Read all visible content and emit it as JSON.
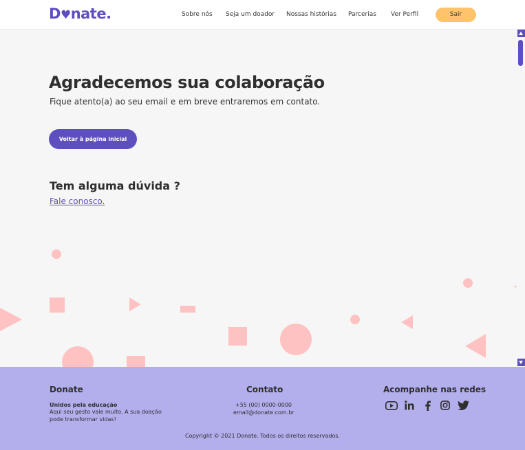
{
  "navbar": {
    "logo": "Donate.",
    "links": [
      "Sobre nós",
      "Seja um doador",
      "Nossas histórias",
      "Parcerias",
      "Ver Perfil"
    ],
    "logout_label": "Sair"
  },
  "main": {
    "title": "Agradecemos sua colaboração",
    "subtitle": "Fique atento(a) ao seu email e em breve entraremos em contato.",
    "home_button": "Voltar à página inicial",
    "question": "Tem alguma dúvida ?",
    "contact_link": "Fale conosco."
  },
  "footer": {
    "about": {
      "title": "Donate",
      "tagline": "Unidos pela educação",
      "line1": "Aqui seu gesto vale muito. A sua doação",
      "line2": "pode transformar vidas!"
    },
    "contact": {
      "title": "Contato",
      "phone": "+55 (00) 0000-0000",
      "email": "email@donate.com.br"
    },
    "social": {
      "title": "Acompanhe nas redes",
      "icons": [
        "youtube-icon",
        "linkedin-icon",
        "facebook-icon",
        "instagram-icon",
        "twitter-icon"
      ]
    },
    "copyright": "Copyright © 2021 Donate. Todos os direitos reservados."
  },
  "colors": {
    "brand": "#5e4fbf",
    "accent": "#ffc46b",
    "footer_bg": "#b3aeec",
    "shapes": "#ffc2c2"
  }
}
